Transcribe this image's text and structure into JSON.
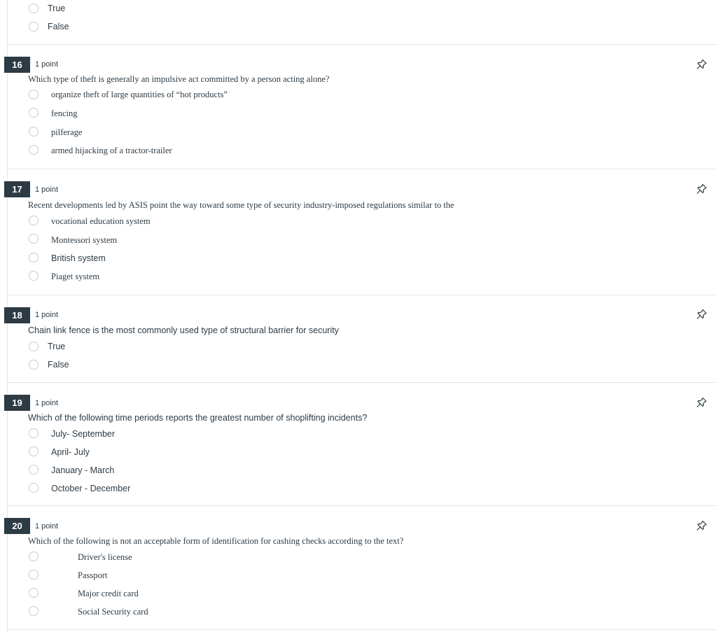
{
  "prev_question": {
    "answers": [
      "True",
      "False"
    ]
  },
  "questions": [
    {
      "number": "16",
      "points": "1 point",
      "text": "Which type of theft is generally an impulsive act committed by a person acting alone?",
      "answers": [
        "organize theft of large quantities of “hot products”",
        "fencing",
        "pilferage",
        "armed hijacking of a tractor-trailer"
      ]
    },
    {
      "number": "17",
      "points": "1 point",
      "text": "Recent developments led by ASIS point the way toward some type of security industry-imposed regulations similar to the",
      "answers": [
        "vocational education system",
        "Montessori system",
        "British system",
        "Piaget system"
      ]
    },
    {
      "number": "18",
      "points": "1 point",
      "text": "Chain link fence is the most commonly used type of structural barrier for security",
      "answers": [
        "True",
        "False"
      ]
    },
    {
      "number": "19",
      "points": "1 point",
      "text": "Which of the following time periods reports the greatest number of shoplifting incidents?",
      "answers": [
        "July- September",
        "April- July",
        "January - March",
        "October - December"
      ]
    },
    {
      "number": "20",
      "points": "1 point",
      "text": "Which of the following is not an acceptable form of identification for cashing checks according to the text?",
      "answers": [
        "Driver's license",
        "Passport",
        "Major credit card",
        "Social Security card"
      ]
    }
  ],
  "icons": {
    "pin": "pin-icon"
  },
  "colors": {
    "number_badge_bg": "#2d3b45",
    "text": "#2d3b45",
    "radio_border": "#c7cdd1",
    "divider": "#e6e6e6"
  }
}
